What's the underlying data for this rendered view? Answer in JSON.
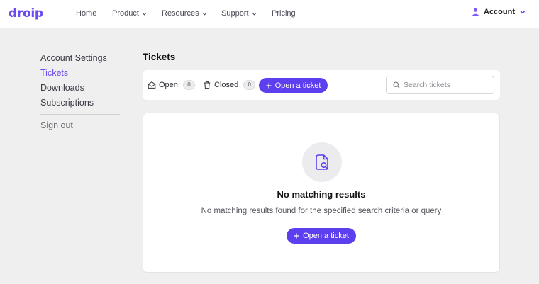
{
  "brand": {
    "logo_text": "droip"
  },
  "nav": {
    "items": [
      {
        "label": "Home",
        "has_dropdown": false
      },
      {
        "label": "Product",
        "has_dropdown": true
      },
      {
        "label": "Resources",
        "has_dropdown": true
      },
      {
        "label": "Support",
        "has_dropdown": true
      },
      {
        "label": "Pricing",
        "has_dropdown": false
      }
    ],
    "account_label": "Account"
  },
  "sidebar": {
    "items": [
      {
        "label": "Account Settings",
        "active": false
      },
      {
        "label": "Tickets",
        "active": true
      },
      {
        "label": "Downloads",
        "active": false
      },
      {
        "label": "Subscriptions",
        "active": false
      }
    ],
    "sign_out_label": "Sign out"
  },
  "page": {
    "title": "Tickets"
  },
  "toolbar": {
    "open_label": "Open",
    "open_count": "0",
    "closed_label": "Closed",
    "closed_count": "0",
    "new_ticket_label": "Open a ticket",
    "search_placeholder": "Search tickets"
  },
  "empty_state": {
    "title": "No matching results",
    "description": "No matching results found for the specified search criteria or query",
    "button_label": "Open a ticket"
  },
  "colors": {
    "accent": "#5d3ff0",
    "logo": "#6c4cf0",
    "background": "#efeff0"
  },
  "icons": [
    "chevron-down-icon",
    "user-icon",
    "envelope-open-icon",
    "trash-icon",
    "plus-icon",
    "search-icon",
    "document-search-icon"
  ]
}
